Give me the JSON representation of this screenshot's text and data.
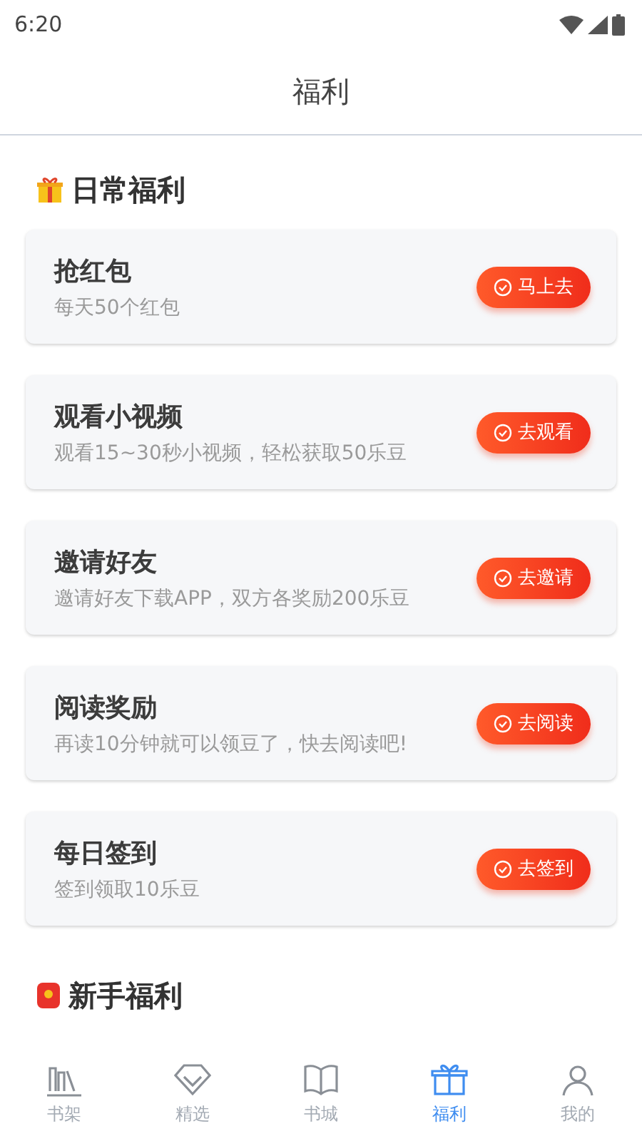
{
  "status_bar": {
    "time": "6:20"
  },
  "header": {
    "title": "福利"
  },
  "sections": [
    {
      "title": "日常福利",
      "tasks": [
        {
          "title": "抢红包",
          "desc": "每天50个红包",
          "button": "马上去"
        },
        {
          "title": "观看小视频",
          "desc": "观看15~30秒小视频，轻松获取50乐豆",
          "button": "去观看"
        },
        {
          "title": "邀请好友",
          "desc": "邀请好友下载APP，双方各奖励200乐豆",
          "button": "去邀请"
        },
        {
          "title": "阅读奖励",
          "desc": "再读10分钟就可以领豆了，快去阅读吧!",
          "button": "去阅读"
        },
        {
          "title": "每日签到",
          "desc": "签到领取10乐豆",
          "button": "去签到"
        }
      ]
    },
    {
      "title": "新手福利"
    }
  ],
  "tab_bar": [
    {
      "label": "书架",
      "selected": false
    },
    {
      "label": "精选",
      "selected": false
    },
    {
      "label": "书城",
      "selected": false
    },
    {
      "label": "福利",
      "selected": true
    },
    {
      "label": "我的",
      "selected": false
    }
  ]
}
